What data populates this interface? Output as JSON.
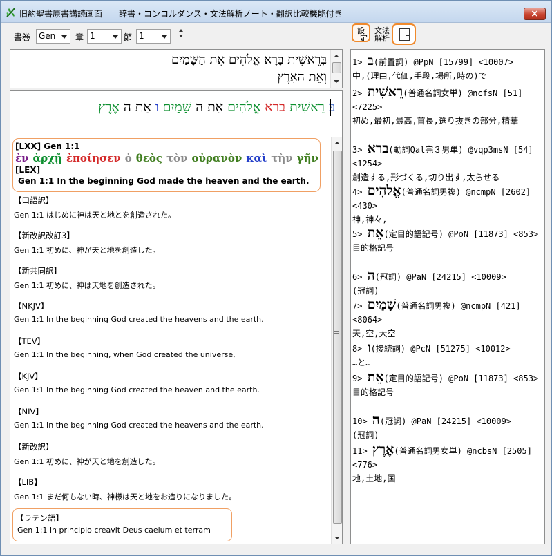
{
  "window": {
    "title": "旧約聖書原書講読画面　　辞書・コンコルダンス・文法解析ノート・翻訳比較機能付き",
    "close_label": "×"
  },
  "toolbar": {
    "book_label": "書巻",
    "book_value": "Gen",
    "chapter_label": "章",
    "chapter_value": "1",
    "verse_label": "節",
    "verse_value": "1",
    "settings_button_line1": "設",
    "settings_button_line2": "定",
    "grammar_button_line1": "文法",
    "grammar_button_line2": "解析"
  },
  "hebrew_text": {
    "line1": "בְּרֵאשִׁית בָּרָא אֱלֹהִים אֵת הַשָּׁמַיִם",
    "line2": "וְאֵת הָאָרֶץ"
  },
  "colored_verse": [
    {
      "text": "בּ",
      "color": "#5b7fd0"
    },
    {
      "text": "רֵאשִׁית",
      "color": "#0d8f2f"
    },
    {
      "text": "ברא",
      "color": "#d42a2a"
    },
    {
      "text": "אֱלֹהִים",
      "color": "#0d8f2f"
    },
    {
      "text": "אֵת",
      "color": "#000000"
    },
    {
      "text": "ה",
      "color": "#000000"
    },
    {
      "text": "שָׁמַיִם",
      "color": "#0d8f2f"
    },
    {
      "text": "ו",
      "color": "#243fc9"
    },
    {
      "text": "אֵת",
      "color": "#000000"
    },
    {
      "text": "ה",
      "color": "#000000"
    },
    {
      "text": "אֶרֶץ",
      "color": "#0d8f2f"
    }
  ],
  "lxx": {
    "header": "[LXX] Gen 1:1",
    "greek_words": [
      {
        "text": "ἐν",
        "color": "#7a1e8a"
      },
      {
        "text": "ἀρχῇ",
        "color": "#0d8f2f"
      },
      {
        "text": "ἐποίησεν",
        "color": "#d42a2a"
      },
      {
        "text": "ὁ",
        "color": "#8a8a8a"
      },
      {
        "text": "θεὸς",
        "color": "#3f7d1e"
      },
      {
        "text": "τὸν",
        "color": "#8a8a8a"
      },
      {
        "text": "οὐρανὸν",
        "color": "#3f7d1e"
      },
      {
        "text": "καὶ",
        "color": "#243fc9"
      },
      {
        "text": "τὴν",
        "color": "#8a8a8a"
      },
      {
        "text": "γῆν",
        "color": "#3f7d1e"
      }
    ],
    "lex_header": "[LEX]",
    "lex_text": "Gen 1:1 In the beginning God made the heaven and the earth."
  },
  "translations": [
    {
      "header": "【口語訳】",
      "text": "Gen 1:1 はじめに神は天と地とを創造された。"
    },
    {
      "header": "【新改訳改訂3】",
      "text": "Gen 1:1 初めに、神が天と地を創造した。"
    },
    {
      "header": "【新共同訳】",
      "text": "Gen 1:1 初めに、神は天地を創造された。"
    },
    {
      "header": "【NKJV】",
      "text": "Gen 1:1 In the beginning God created the heavens and the earth."
    },
    {
      "header": "【TEV】",
      "text": "Gen 1:1 In the beginning, when God created the universe,"
    },
    {
      "header": "【KJV】",
      "text": "Gen 1:1 In the beginning God created the heaven and the earth."
    },
    {
      "header": "【NIV】",
      "text": "Gen 1:1 In the beginning God created the heavens and the earth."
    },
    {
      "header": "【新改訳】",
      "text": "Gen 1:1 初めに、神が天と地を創造した。"
    },
    {
      "header": "【LIB】",
      "text": "Gen 1:1 まだ何もない時、神様は天と地をお造りになりました。"
    }
  ],
  "latin": {
    "header": "【ラテン語】",
    "text": "Gen 1:1 in principio creavit Deus caelum et terram"
  },
  "dictionary": [
    {
      "num": "1>",
      "word": "בּ",
      "info": "(前置詞) @PpN [15799] <10007>",
      "gloss": "中,(理由,代価,手段,場所,時の)で"
    },
    {
      "num": "2>",
      "word": "רֵאשִׁית",
      "info": "(普通名詞女単) @ncfsN [51] <7225>",
      "gloss": "初め,最初,最高,首長,選り抜きの部分,精華"
    },
    {
      "num": "3>",
      "word": "ברא",
      "info": "(動詞Qal完３男単) @vqp3msN [54] <1254>",
      "gloss": "創造する,形づくる,切り出す,太らせる"
    },
    {
      "num": "4>",
      "word": "אֱלֹהִים",
      "info": "(普通名詞男複) @ncmpN [2602] <430>",
      "gloss": "神,神々,"
    },
    {
      "num": "5>",
      "word": "אֵת",
      "info": "(定目的語記号) @PoN [11873] <853>",
      "gloss": "目的格記号"
    },
    {
      "num": "6>",
      "word": "ה",
      "info": "(冠詞) @PaN [24215] <10009>",
      "gloss": "(冠詞)"
    },
    {
      "num": "7>",
      "word": "שָׁמַיִם",
      "info": "(普通名詞男複) @ncmpN [421] <8064>",
      "gloss": "天,空,大空"
    },
    {
      "num": "8>",
      "word": "ו",
      "info": "(接続詞) @PcN [51275] <10012>",
      "gloss": "…と…"
    },
    {
      "num": "9>",
      "word": "אֵת",
      "info": "(定目的語記号) @PoN [11873] <853>",
      "gloss": "目的格記号"
    },
    {
      "num": "10>",
      "word": "ה",
      "info": "(冠詞) @PaN [24215] <10009>",
      "gloss": "(冠詞)"
    },
    {
      "num": "11>",
      "word": "אֶרֶץ",
      "info": "(普通名詞男女単) @ncbsN [2505] <776>",
      "gloss": "地,土地,国"
    }
  ]
}
